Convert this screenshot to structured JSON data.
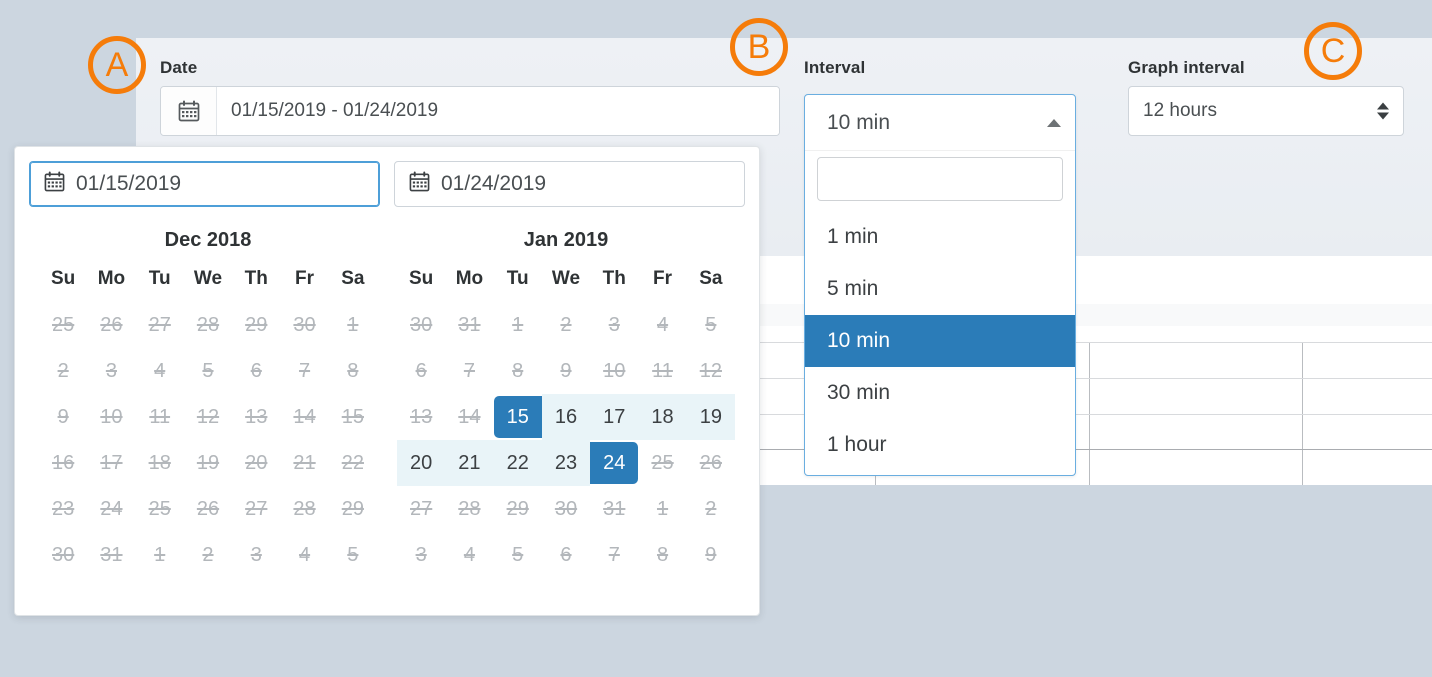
{
  "background_color": "#ccd6e0",
  "accent_color": "#2b7cb8",
  "marker_color": "#f57c0a",
  "markers": [
    {
      "label": "A",
      "name": "annotation-marker-a"
    },
    {
      "label": "B",
      "name": "annotation-marker-b"
    },
    {
      "label": "C",
      "name": "annotation-marker-c"
    }
  ],
  "toolbar": {
    "date": {
      "label": "Date",
      "value": "01/15/2019 - 01/24/2019",
      "icon": "calendar-icon"
    },
    "interval": {
      "label": "Interval",
      "selected": "10 min",
      "search_value": "",
      "search_placeholder": "",
      "caret_icon": "caret-up-icon",
      "options": [
        "1 min",
        "5 min",
        "10 min",
        "30 min",
        "1 hour"
      ]
    },
    "graph_interval": {
      "label": "Graph interval",
      "selected": "12 hours",
      "spinner_icon": "spinner-updown-icon"
    }
  },
  "calendar": {
    "start_input": {
      "value": "01/15/2019",
      "icon": "calendar-icon",
      "focused": true
    },
    "end_input": {
      "value": "01/24/2019",
      "icon": "calendar-icon",
      "focused": false
    },
    "weekday_headers": [
      "Su",
      "Mo",
      "Tu",
      "We",
      "Th",
      "Fr",
      "Sa"
    ],
    "range_start": "2019-01-15",
    "range_end": "2019-01-24",
    "months": [
      {
        "title": "Dec 2018",
        "weeks": [
          [
            {
              "d": "25",
              "s": "muted"
            },
            {
              "d": "26",
              "s": "muted"
            },
            {
              "d": "27",
              "s": "muted"
            },
            {
              "d": "28",
              "s": "muted"
            },
            {
              "d": "29",
              "s": "muted"
            },
            {
              "d": "30",
              "s": "muted"
            },
            {
              "d": "1",
              "s": "muted"
            }
          ],
          [
            {
              "d": "2",
              "s": "muted"
            },
            {
              "d": "3",
              "s": "muted"
            },
            {
              "d": "4",
              "s": "muted"
            },
            {
              "d": "5",
              "s": "muted"
            },
            {
              "d": "6",
              "s": "muted"
            },
            {
              "d": "7",
              "s": "muted"
            },
            {
              "d": "8",
              "s": "muted"
            }
          ],
          [
            {
              "d": "9",
              "s": "muted"
            },
            {
              "d": "10",
              "s": "muted"
            },
            {
              "d": "11",
              "s": "muted"
            },
            {
              "d": "12",
              "s": "muted"
            },
            {
              "d": "13",
              "s": "muted"
            },
            {
              "d": "14",
              "s": "muted"
            },
            {
              "d": "15",
              "s": "muted"
            }
          ],
          [
            {
              "d": "16",
              "s": "muted"
            },
            {
              "d": "17",
              "s": "muted"
            },
            {
              "d": "18",
              "s": "muted"
            },
            {
              "d": "19",
              "s": "muted"
            },
            {
              "d": "20",
              "s": "muted"
            },
            {
              "d": "21",
              "s": "muted"
            },
            {
              "d": "22",
              "s": "muted"
            }
          ],
          [
            {
              "d": "23",
              "s": "muted"
            },
            {
              "d": "24",
              "s": "muted"
            },
            {
              "d": "25",
              "s": "muted"
            },
            {
              "d": "26",
              "s": "muted"
            },
            {
              "d": "27",
              "s": "muted"
            },
            {
              "d": "28",
              "s": "muted"
            },
            {
              "d": "29",
              "s": "muted"
            }
          ],
          [
            {
              "d": "30",
              "s": "muted"
            },
            {
              "d": "31",
              "s": "muted"
            },
            {
              "d": "1",
              "s": "muted"
            },
            {
              "d": "2",
              "s": "muted"
            },
            {
              "d": "3",
              "s": "muted"
            },
            {
              "d": "4",
              "s": "muted"
            },
            {
              "d": "5",
              "s": "muted"
            }
          ]
        ]
      },
      {
        "title": "Jan 2019",
        "weeks": [
          [
            {
              "d": "30",
              "s": "muted"
            },
            {
              "d": "31",
              "s": "muted"
            },
            {
              "d": "1",
              "s": "muted"
            },
            {
              "d": "2",
              "s": "muted"
            },
            {
              "d": "3",
              "s": "muted"
            },
            {
              "d": "4",
              "s": "muted"
            },
            {
              "d": "5",
              "s": "muted"
            }
          ],
          [
            {
              "d": "6",
              "s": "muted"
            },
            {
              "d": "7",
              "s": "muted"
            },
            {
              "d": "8",
              "s": "muted"
            },
            {
              "d": "9",
              "s": "muted"
            },
            {
              "d": "10",
              "s": "muted"
            },
            {
              "d": "11",
              "s": "muted"
            },
            {
              "d": "12",
              "s": "muted"
            }
          ],
          [
            {
              "d": "13",
              "s": "muted"
            },
            {
              "d": "14",
              "s": "muted"
            },
            {
              "d": "15",
              "s": "edge start"
            },
            {
              "d": "16",
              "s": "inrange"
            },
            {
              "d": "17",
              "s": "inrange"
            },
            {
              "d": "18",
              "s": "inrange"
            },
            {
              "d": "19",
              "s": "inrange"
            }
          ],
          [
            {
              "d": "20",
              "s": "inrange"
            },
            {
              "d": "21",
              "s": "inrange"
            },
            {
              "d": "22",
              "s": "inrange"
            },
            {
              "d": "23",
              "s": "inrange"
            },
            {
              "d": "24",
              "s": "edge end"
            },
            {
              "d": "25",
              "s": "muted"
            },
            {
              "d": "26",
              "s": "muted"
            }
          ],
          [
            {
              "d": "27",
              "s": "muted"
            },
            {
              "d": "28",
              "s": "muted"
            },
            {
              "d": "29",
              "s": "muted"
            },
            {
              "d": "30",
              "s": "muted"
            },
            {
              "d": "31",
              "s": "muted"
            },
            {
              "d": "1",
              "s": "muted"
            },
            {
              "d": "2",
              "s": "muted"
            }
          ],
          [
            {
              "d": "3",
              "s": "muted"
            },
            {
              "d": "4",
              "s": "muted"
            },
            {
              "d": "5",
              "s": "muted"
            },
            {
              "d": "6",
              "s": "muted"
            },
            {
              "d": "7",
              "s": "muted"
            },
            {
              "d": "8",
              "s": "muted"
            },
            {
              "d": "9",
              "s": "muted"
            }
          ]
        ]
      }
    ]
  },
  "chart_background": {
    "vertical_line_count": 9,
    "horizontal_line_count": 4
  }
}
